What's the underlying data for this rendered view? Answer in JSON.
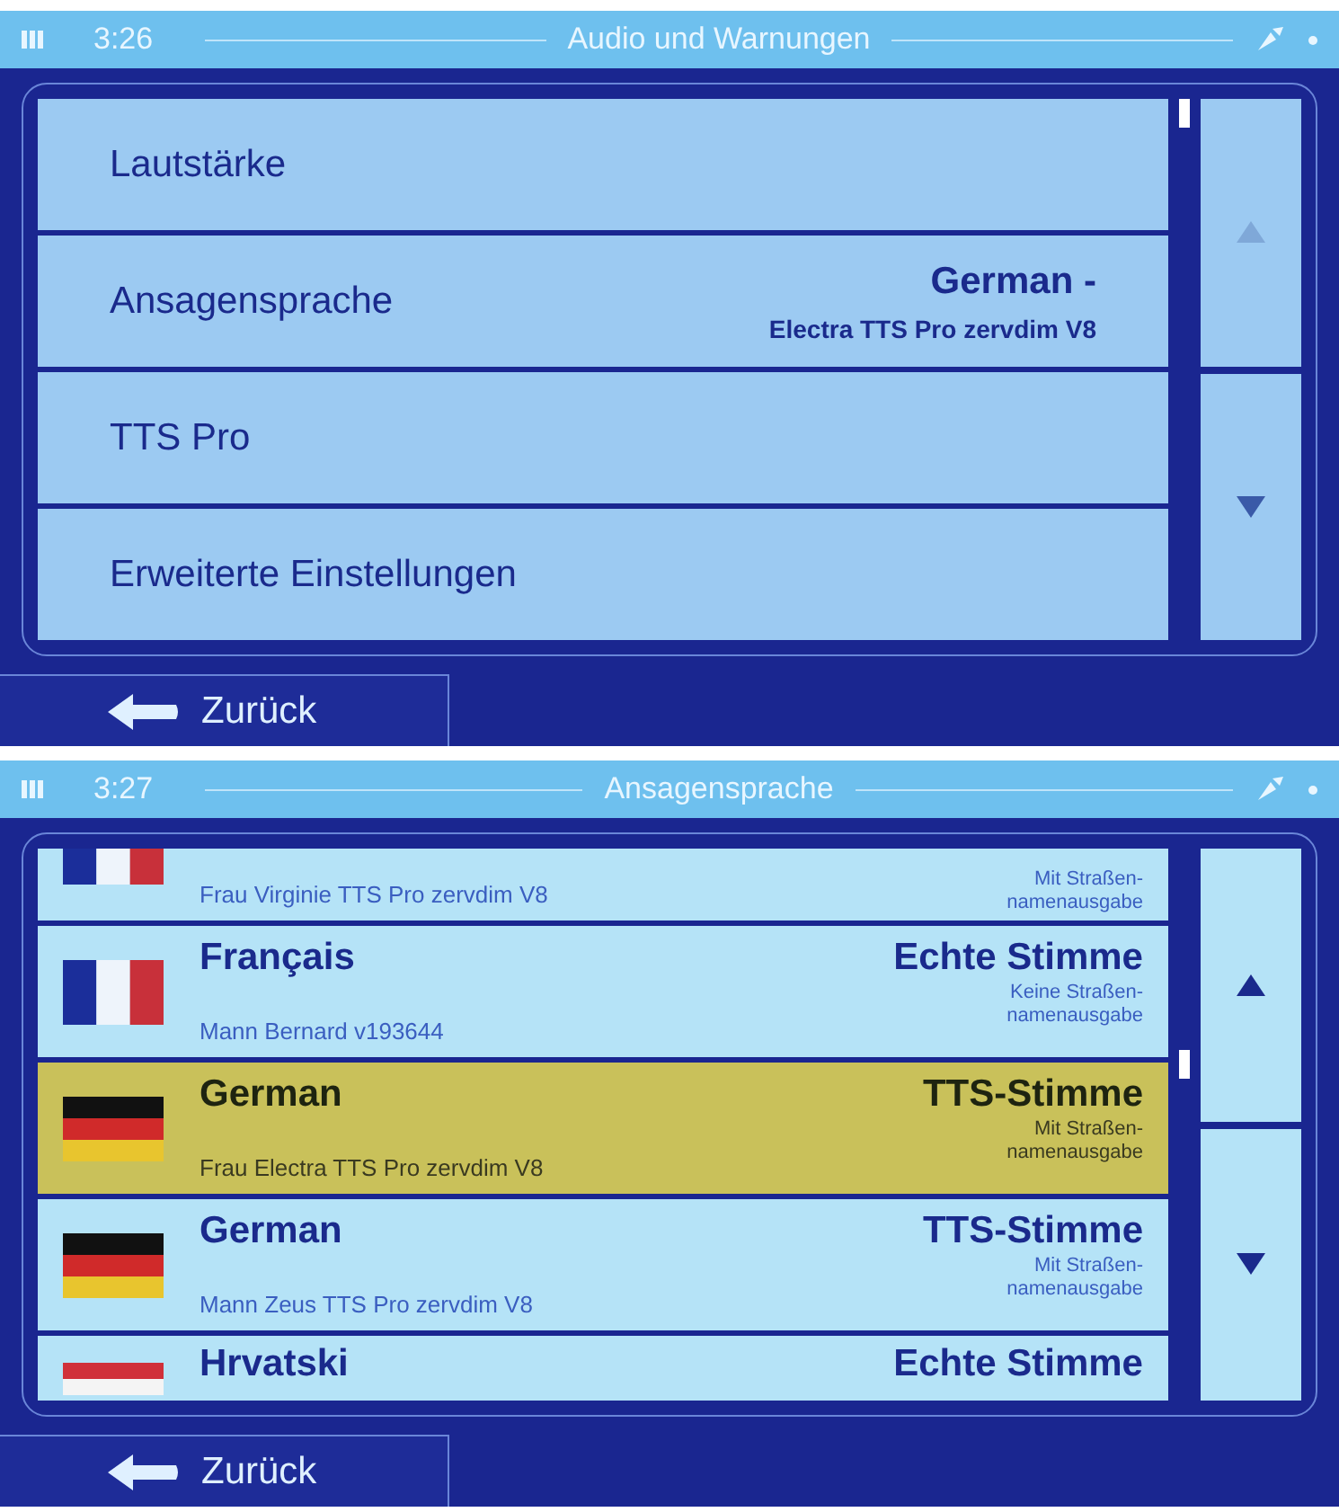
{
  "screens": [
    {
      "status": {
        "time": "3:26",
        "title": "Audio und Warnungen"
      },
      "kind": "menu",
      "items": [
        {
          "label": "Lautstärke"
        },
        {
          "label": "Ansagensprache",
          "value": "German -",
          "detail": "Electra TTS Pro zervdim V8"
        },
        {
          "label": "TTS Pro"
        },
        {
          "label": "Erweiterte Einstellungen"
        }
      ],
      "back": "Zurück"
    },
    {
      "status": {
        "time": "3:27",
        "title": "Ansagensprache"
      },
      "kind": "voices",
      "voices": [
        {
          "kind": "partial-top",
          "flag": {
            "kind": "vertical",
            "stripes": [
              {
                "color": "#1b2e9a"
              },
              {
                "color": "#eef4fb"
              },
              {
                "color": "#c8303a"
              }
            ]
          },
          "voice": "Frau Virginie TTS Pro zervdim V8",
          "note": "Mit Straßen-\nnamenausgabe",
          "selected": false
        },
        {
          "kind": "full",
          "flag": {
            "kind": "vertical",
            "stripes": [
              {
                "color": "#1b2e9a"
              },
              {
                "color": "#eef4fb"
              },
              {
                "color": "#c8303a"
              }
            ]
          },
          "name": "Français",
          "type": "Echte Stimme",
          "voice": "Mann Bernard v193644",
          "note": "Keine Straßen-\nnamenausgabe",
          "selected": false
        },
        {
          "kind": "full",
          "flag": {
            "kind": "horizontal",
            "stripes": [
              {
                "color": "#111111"
              },
              {
                "color": "#d02a2a"
              },
              {
                "color": "#e8c52e"
              }
            ]
          },
          "name": "German",
          "type": "TTS-Stimme",
          "voice": "Frau Electra TTS Pro zervdim V8",
          "note": "Mit Straßen-\nnamenausgabe",
          "selected": true
        },
        {
          "kind": "full",
          "flag": {
            "kind": "horizontal",
            "stripes": [
              {
                "color": "#111111"
              },
              {
                "color": "#d02a2a"
              },
              {
                "color": "#e8c52e"
              }
            ]
          },
          "name": "German",
          "type": "TTS-Stimme",
          "voice": "Mann Zeus TTS Pro zervdim V8",
          "note": "Mit Straßen-\nnamenausgabe",
          "selected": false
        },
        {
          "kind": "partial-bottom",
          "flag": {
            "kind": "horizontal",
            "stripes": [
              {
                "color": "#d0303a"
              },
              {
                "color": "#f4f4f4"
              }
            ]
          },
          "name": "Hrvatski",
          "type": "Echte Stimme",
          "selected": false
        }
      ],
      "back": "Zurück"
    }
  ]
}
